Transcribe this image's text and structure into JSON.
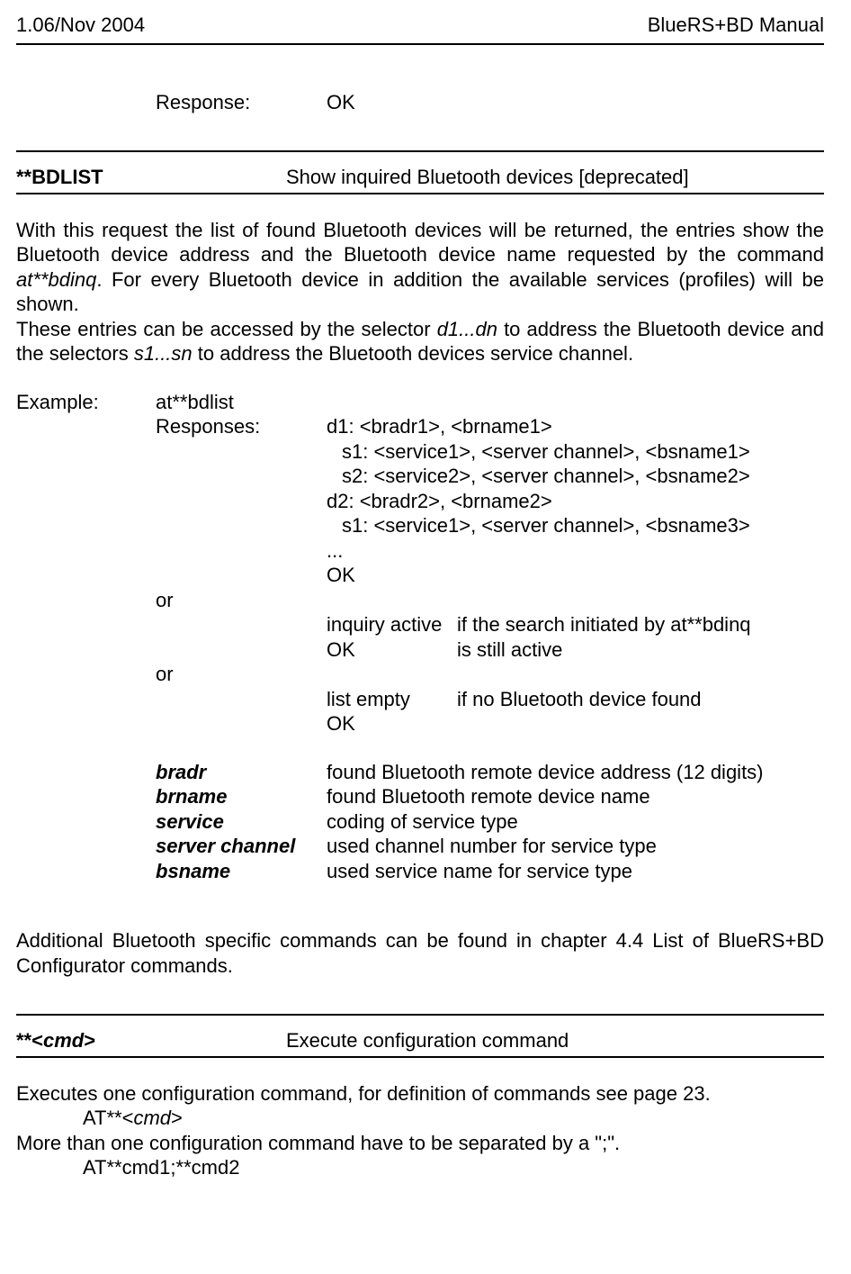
{
  "header": {
    "left": "1.06/Nov 2004",
    "right": "BlueRS+BD Manual"
  },
  "topResponse": {
    "label": "Response:",
    "value": "OK"
  },
  "bdlist": {
    "cmd": "**BDLIST",
    "title": "Show inquired Bluetooth devices [deprecated]",
    "para1": "With this request the list of found Bluetooth devices will be returned, the entries show the Bluetooth device address and the Bluetooth device name requested by the command ",
    "para1_ital": "at**bdinq",
    "para1_cont": ". For every Bluetooth device in addition the available services (profiles) will be shown.",
    "para2_a": "These entries can be accessed by the selector ",
    "para2_ital1": "d1...dn",
    "para2_b": " to address the Bluetooth device and the selectors ",
    "para2_ital2": "s1...sn",
    "para2_c": " to address the Bluetooth devices service channel.",
    "example_label": "Example:",
    "example_cmd": "at**bdlist",
    "responses_label": "Responses:",
    "resp_lines": {
      "l1": "d1: <bradr1>, <brname1>",
      "l2": "s1: <service1>, <server channel>, <bsname1>",
      "l3": "s2: <service2>, <server channel>, <bsname2>",
      "l4": "d2: <bradr2>, <brname2>",
      "l5": "s1: <service1>, <server channel>, <bsname3>",
      "l6": "...",
      "l7": "OK"
    },
    "or": "or",
    "alt1": {
      "left1": "inquiry active",
      "right1": "if the search initiated by at**bdinq",
      "left2": "OK",
      "right2": "is still active"
    },
    "alt2": {
      "left1": "list empty",
      "right1": "if no Bluetooth device found",
      "left2": "OK"
    },
    "params": {
      "p1": {
        "name": "bradr",
        "desc": "found Bluetooth remote device address (12 digits)"
      },
      "p2": {
        "name": "brname",
        "desc": "found Bluetooth remote device name"
      },
      "p3": {
        "name": "service",
        "desc": "coding of service type"
      },
      "p4": {
        "name": "server channel",
        "desc": "used channel number for service type"
      },
      "p5": {
        "name": "bsname",
        "desc": "used service name for service type"
      }
    },
    "after": "Additional Bluetooth specific commands can be found in chapter 4.4 List of BlueRS+BD Configurator commands."
  },
  "cmd": {
    "cmd_a": "**<",
    "cmd_b": "cmd",
    "cmd_c": ">",
    "title": "Execute configuration command",
    "p1": "Executes one configuration command, for definition of commands see page 23.",
    "p1_code_a": "AT**<",
    "p1_code_b": "cmd",
    "p1_code_c": ">",
    "p2": "More than one configuration command have to be separated by a \";\".",
    "p2_code": "AT**cmd1;**cmd2"
  }
}
